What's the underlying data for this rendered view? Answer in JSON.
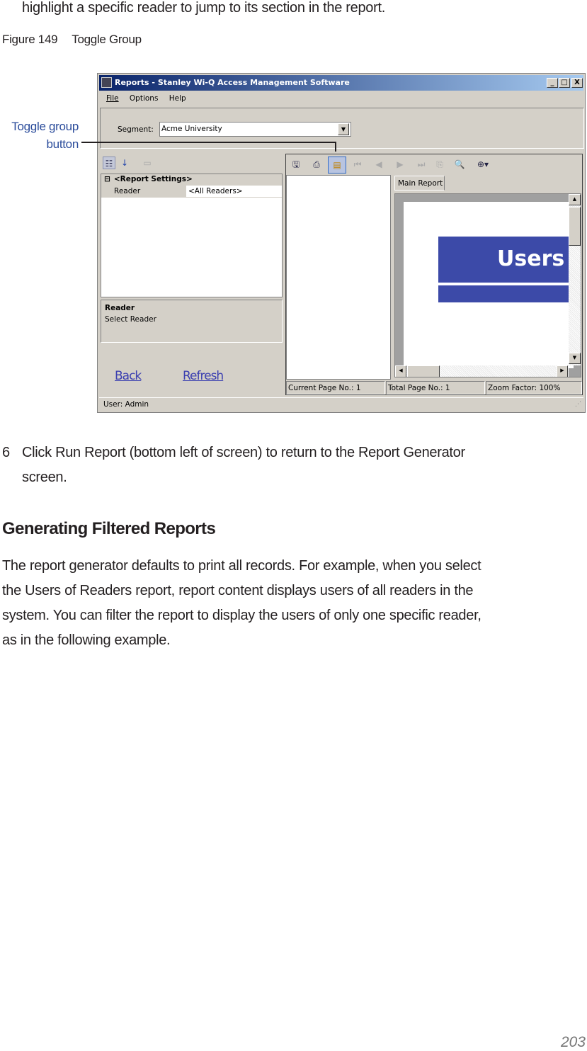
{
  "intro_text": "highlight a specific reader to jump to its section in the report.",
  "figure": {
    "number": "Figure 149",
    "caption": "Toggle Group"
  },
  "callout": {
    "line1": "Toggle group",
    "line2": "button",
    "color": "#2b4c9b"
  },
  "window": {
    "title": "Reports - Stanley Wi-Q Access Management Software",
    "controls": [
      "_",
      "□",
      "X"
    ],
    "menu": [
      "File",
      "Options",
      "Help"
    ],
    "segment_label": "Segment:",
    "segment_value": "Acme University",
    "property_grid": {
      "category": "<Report Settings>",
      "rows": [
        {
          "name": "Reader",
          "value": "<All Readers>"
        }
      ]
    },
    "description": {
      "title": "Reader",
      "text": "Select Reader"
    },
    "links": {
      "back": "Back",
      "refresh": "Refresh"
    },
    "viewer": {
      "tab": "Main Report",
      "banner": "Users",
      "banner_color": "#3c4aa8",
      "toggle_group_active": true
    },
    "status_fields": [
      "Current Page No.: 1",
      "Total Page No.: 1",
      "Zoom Factor: 100%"
    ],
    "statusbar": "User: Admin"
  },
  "step": {
    "number": "6",
    "line1": "Click Run Report (bottom left of screen) to return to the Report Generator",
    "line2": "screen."
  },
  "section": {
    "heading": "Generating Filtered Reports",
    "lines": [
      "The report generator defaults to print all records. For example, when you select",
      "the Users of Readers report, report content displays users of all readers in the",
      "system. You can filter the report to display the users of only one specific reader,",
      "as in the following example."
    ]
  },
  "page_number": "203"
}
